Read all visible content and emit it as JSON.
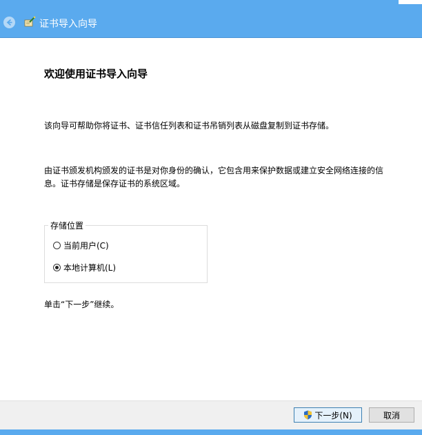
{
  "window": {
    "title": "证书导入向导"
  },
  "page": {
    "heading": "欢迎使用证书导入向导",
    "para1": "该向导可帮助你将证书、证书信任列表和证书吊销列表从磁盘复制到证书存储。",
    "para2": "由证书颁发机构颁发的证书是对你身份的确认，它包含用来保护数据或建立安全网络连接的信息。证书存储是保存证书的系统区域。",
    "store_location": {
      "legend": "存储位置",
      "options": [
        {
          "label": "当前用户(C)",
          "checked": false
        },
        {
          "label": "本地计算机(L)",
          "checked": true
        }
      ]
    },
    "continue_hint": "单击“下一步”继续。"
  },
  "buttons": {
    "next": "下一步(N)",
    "cancel": "取消"
  },
  "colors": {
    "titlebar": "#5aaaee",
    "footer": "#f0f0f0"
  },
  "icons": {
    "back": "back-arrow-icon",
    "wizard": "certificate-wizard-icon",
    "shield": "uac-shield-icon"
  }
}
